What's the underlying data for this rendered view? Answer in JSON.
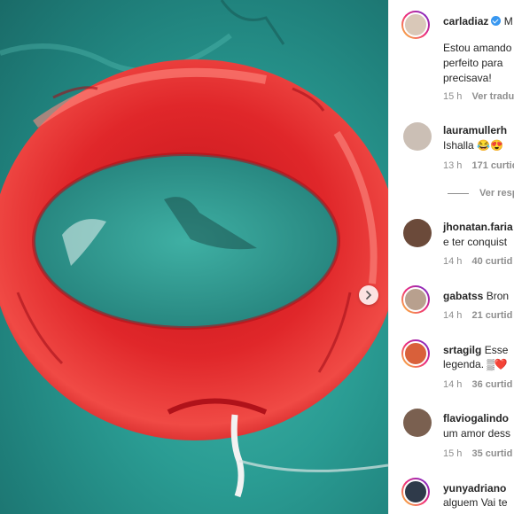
{
  "post": {
    "author": "carladiaz",
    "follow_hint": "M",
    "caption_lines": [
      "Estou amando",
      "perfeito para",
      "precisava!"
    ],
    "time": "15 h",
    "translate": "Ver tradu"
  },
  "comments": [
    {
      "user": "lauramullerh",
      "lines": [
        "Ishalla 😂😍"
      ],
      "time": "13 h",
      "likes": "171 curtid",
      "replies": "Ver resp"
    },
    {
      "user": "jhonatan.faria",
      "lines": [
        "e ter conquist"
      ],
      "time": "14 h",
      "likes": "40 curtid"
    },
    {
      "user": "gabatss",
      "lines": [
        "Bron"
      ],
      "time": "14 h",
      "likes": "21 curtid"
    },
    {
      "user": "srtagilg",
      "lines": [
        "Esse",
        "legenda. ▒❤️"
      ],
      "time": "14 h",
      "likes": "36 curtid"
    },
    {
      "user": "flaviogalindo",
      "lines": [
        "um amor dess"
      ],
      "time": "15 h",
      "likes": "35 curtid"
    },
    {
      "user": "yunyadriano",
      "lines": [
        "alguem Vai te"
      ]
    }
  ],
  "icons": {
    "next": "chevron-right-icon",
    "verified": "verified-badge-icon"
  },
  "colors": {
    "ring": "#e8322d",
    "water": "#2a9c93",
    "story_ring": "#ee2a7b"
  }
}
